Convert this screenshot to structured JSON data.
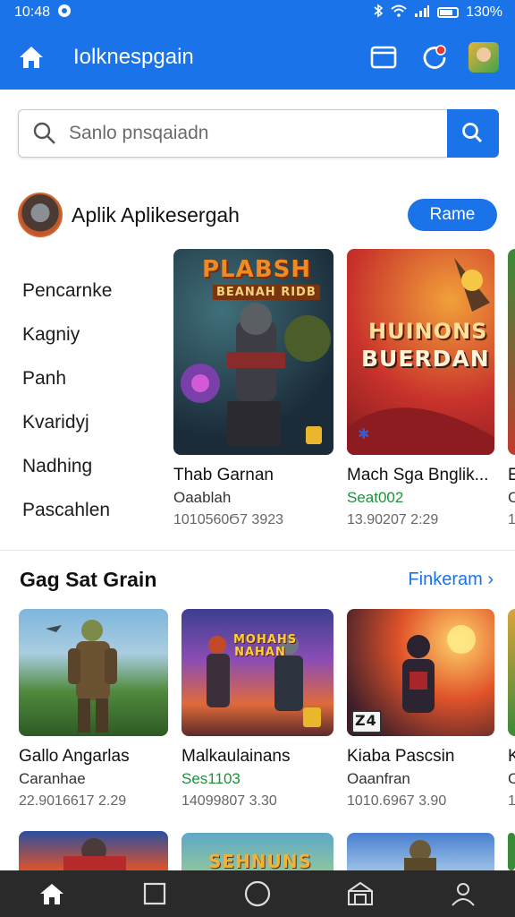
{
  "status": {
    "time": "10:48",
    "battery": "130%"
  },
  "app_bar": {
    "title": "Iolknespgain"
  },
  "search": {
    "placeholder": "Sanlo pnsqaiadn"
  },
  "section1": {
    "title": "Aplik Aplikesergah",
    "button_label": "Rame",
    "categories": [
      "Pencarnke",
      "Kagniy",
      "Panh",
      "Kvaridyj",
      "Nadhing",
      "Pascahlen"
    ],
    "cards": [
      {
        "art_text_1": "PLABSH",
        "art_text_2": "BEANAH RIDB",
        "title": "Thab Garnan",
        "subtitle": "Oaablah",
        "meta": "1010560Ϭ7 3923"
      },
      {
        "art_text_1": "HUINONS",
        "art_text_2": "BUERDAN",
        "title": "Mach Sga Bnglik...",
        "subtitle": "Seat002",
        "meta": "13.90207 2:29"
      },
      {
        "title": "E",
        "subtitle": "C",
        "meta": "1"
      }
    ]
  },
  "section2": {
    "title": "Gag Sat Grain",
    "link_label": "Finkeram",
    "cards": [
      {
        "title": "Gallo Angarlas",
        "subtitle": "Caranhae",
        "meta": "22.9016617 2.29"
      },
      {
        "art_text": "MOHAHS NAHAN",
        "title": "Malkaulainans",
        "subtitle": "Ses1103",
        "meta": "14099807 3.30"
      },
      {
        "art_text": "Z4",
        "title": "Kiaba Pascsin",
        "subtitle": "Oaanfran",
        "meta": "1010.6967 3.90"
      },
      {
        "title": "K",
        "subtitle": "C",
        "meta": "1"
      }
    ],
    "bottom_row_art_text": "SEHNUNS"
  },
  "colors": {
    "accent": "#1a73e8",
    "nav_bg": "#2a2a2a",
    "green_text": "#1f8f3a"
  }
}
